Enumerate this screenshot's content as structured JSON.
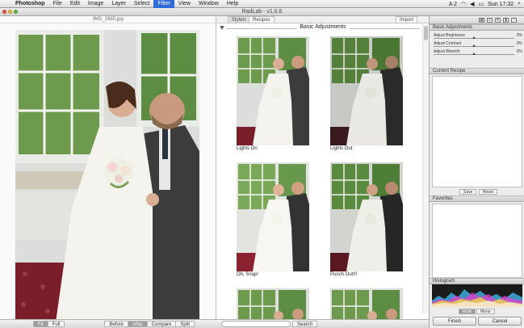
{
  "menubar": {
    "app": "Photoshop",
    "items": [
      "File",
      "Edit",
      "Image",
      "Layer",
      "Select",
      "Filter",
      "View",
      "Window",
      "Help"
    ],
    "active": "Filter",
    "status": {
      "flags": "A 2",
      "clock": "Sun 17:32"
    }
  },
  "window": {
    "title": "RadLab - v1.0.6"
  },
  "preview": {
    "filename": "IMG_1885.jpg"
  },
  "left_bottom": {
    "fit": "Fit",
    "full": "Full",
    "before": "Before",
    "after": "After",
    "compare": "Compare",
    "split": "Split"
  },
  "browser": {
    "tabs": {
      "stylets": "Stylets",
      "recipes": "Recipes",
      "import": "Import"
    },
    "section_title": "Basic Adjustments",
    "thumbs": [
      {
        "label": "Lights On"
      },
      {
        "label": "Lights Out"
      },
      {
        "label": "Oh, Snap!"
      },
      {
        "label": "Punch Out!!!"
      }
    ],
    "search_label": "Search"
  },
  "right": {
    "basic_adjustments": {
      "title": "Basic Adjustments",
      "rows": [
        {
          "label": "Adjust Brightness",
          "value": "0%",
          "level": 0.5
        },
        {
          "label": "Adjust Contrast",
          "value": "0%",
          "level": 0.5
        },
        {
          "label": "Adjust Warmth",
          "value": "0%",
          "level": 0.5
        }
      ]
    },
    "current_recipe": {
      "title": "Current Recipe",
      "save": "Save",
      "reset": "Reset"
    },
    "favorites": {
      "title": "Favorites"
    },
    "histogram": {
      "title": "Histogram",
      "rgb": "RGB",
      "mono": "Mono"
    },
    "finish": "Finish",
    "cancel": "Cancel"
  },
  "colors": {
    "accent": "#2f6bd8",
    "wall": "#d7d9d4",
    "window_green": "#6e9a4e",
    "carpet": "#7a1f2a",
    "suit": "#3c3c3c",
    "dress": "#f5f3ee"
  }
}
